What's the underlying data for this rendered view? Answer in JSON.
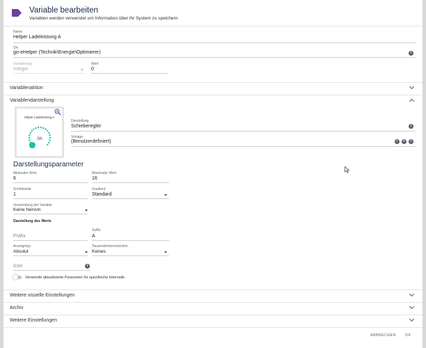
{
  "dialog": {
    "title": "Variable bearbeiten",
    "subtitle": "Variablen werden verwendet um Information über Ihr System zu speichern"
  },
  "fields": {
    "name": {
      "label": "Name",
      "value": "Helper Ladeleistung A"
    },
    "location": {
      "label": "Ort",
      "value": "go-eHelper (Technik\\Energie\\Optimierer)"
    },
    "vartype": {
      "label": "Variablentyp",
      "value": "Integer"
    },
    "value": {
      "label": "Wert",
      "value": "0"
    }
  },
  "sections": {
    "action": "Variablenaktion",
    "display": "Variablendarstellung",
    "visual": "Weitere visuelle Einstellungen",
    "archive": "Archiv",
    "more": "Weitere Einstellungen"
  },
  "preview": {
    "title": "Helper Ladeleistung A",
    "value_text": "0A",
    "level": 0,
    "accent": "#1ebfa8"
  },
  "display": {
    "presentation": {
      "label": "Darstellung",
      "value": "Schieberegler"
    },
    "template": {
      "label": "Vorlage",
      "value": "(Benutzerdefiniert)"
    }
  },
  "params": {
    "heading": "Darstellungsparameter",
    "min": {
      "label": "Minimaler Wert",
      "value": "6"
    },
    "max": {
      "label": "Maximaler Wert",
      "value": "16"
    },
    "step": {
      "label": "Schrittweite",
      "value": "1"
    },
    "gradient": {
      "label": "Gradient",
      "value": "Standard"
    },
    "usage": {
      "label": "Verwendung der Variable",
      "value": "Keine Nervon"
    },
    "value_display_heading": "Darstellung des Werts",
    "prefix": {
      "placeholder": "Präfix"
    },
    "suffix": {
      "label": "Suffix",
      "value": "A"
    },
    "display_type": {
      "label": "Anzeigetyp",
      "value": "Absolut"
    },
    "thousands": {
      "label": "Tausendertrennzeichen",
      "value": "Keines"
    },
    "icon": {
      "placeholder": "Icon"
    },
    "interval_toggle": {
      "label": "Verwende aktualisierte Parameter für spezifische Intervalle",
      "checked": false
    }
  },
  "footer": {
    "cancel": "ABBRECHEN",
    "ok": "OK"
  },
  "icons": {
    "header": "tag-icon",
    "info": "info-icon",
    "search": "zoom-icon",
    "save": "save-icon",
    "clear": "clear-icon"
  },
  "colors": {
    "title": "#1b2a4a",
    "header_icon": "#6b3fa0",
    "gauge": "#1ebfa8"
  }
}
